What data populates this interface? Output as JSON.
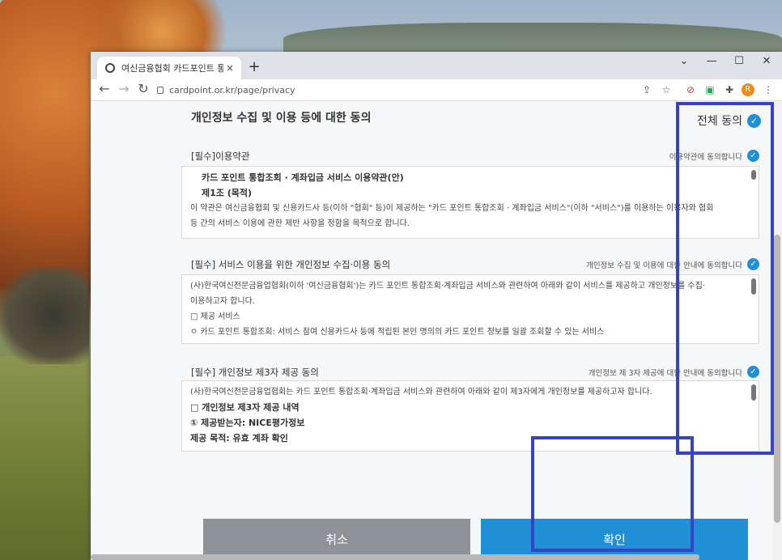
{
  "browser": {
    "tab_title": "여신금융협회 카드포인트 통합조회",
    "tab_close": "×",
    "new_tab": "+",
    "url": "cardpoint.or.kr/page/privacy",
    "profile_initial": "R"
  },
  "page": {
    "heading": "개인정보 수집 및 이용 등에 대한 동의",
    "agree_all": "전체 동의",
    "sections": [
      {
        "title": "[필수]이용약관",
        "agree_text": "이용약관에 동의합니다",
        "lines": [
          "카드 포인트 통합조회 · 계좌입금 서비스 이용약관(안)",
          "제1조 (목적)",
          "이 약관은 여신금융협회 및 신용카드사 등(이하 \"협회\" 등)이 제공하는 \"카드 포인트 통합조회 · 계좌입금 서비스\"(이하 \"서비스\")를 이용하는 이용자와 협회",
          "등 간의 서비스 이용에 관한 제반 사항을 정함을 목적으로 합니다."
        ]
      },
      {
        "title": "[필수] 서비스 이용을 위한 개인정보 수집·이용 동의",
        "agree_text": "개인정보 수집 및 이용에 대한 안내에 동의합니다",
        "lines": [
          "(사)한국여신전문금융업협회(이하 '여신금융협회')는 카드 포인트 통합조회·계좌입금 서비스와 관련하여 아래와 같이 서비스를 제공하고 개인정보를 수집·",
          "이용하고자 합니다.",
          "□ 제공 서비스",
          "ㅇ 카드 포인트 통합조회: 서비스 참여 신용카드사 등에 적립된 본인 명의의 카드 포인트 정보를 일괄 조회할 수 있는 서비스"
        ]
      },
      {
        "title": "[필수] 개인정보 제3자 제공 동의",
        "agree_text": "개인정보 제 3자 제공에 대한 안내에 동의합니다",
        "lines": [
          "(사)한국여신전문금융업협회는 카드 포인트 통합조회·계좌입금 서비스와 관련하여 아래와 같이 제3자에게 개인정보를 제공하고자 합니다.",
          "□ 개인정보 제3자 제공 내역",
          "① 제공받는자: NICE평가정보",
          "제공 목적: 유효 계좌 확인"
        ]
      }
    ],
    "cancel_label": "취소",
    "confirm_label": "확인"
  },
  "colors": {
    "accent": "#1f8fd6",
    "cancel": "#8e9398",
    "annotation": "#3742c8"
  }
}
